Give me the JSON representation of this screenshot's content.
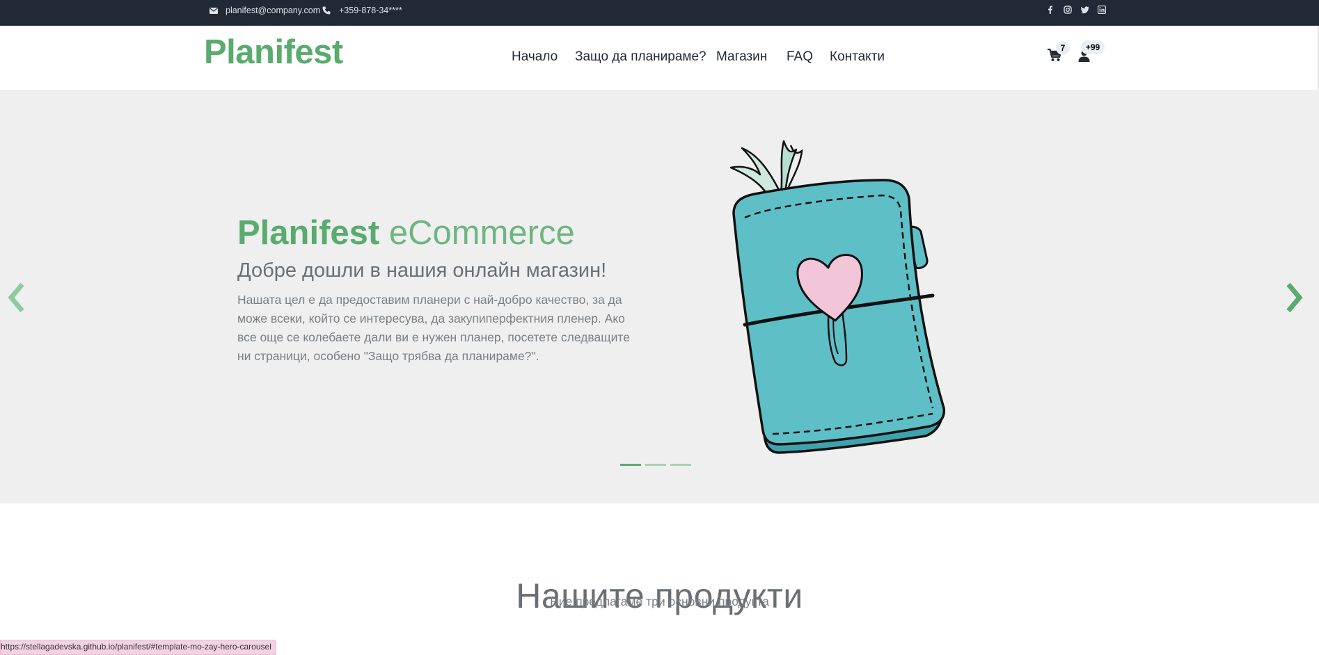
{
  "topbar": {
    "email": "planifest@company.com",
    "phone": "+359-878-34****",
    "email_icon": "envelope-icon",
    "phone_icon": "phone-icon",
    "social": [
      "facebook-icon",
      "instagram-icon",
      "twitter-icon",
      "linkedin-icon"
    ]
  },
  "header": {
    "logo": "Planifest",
    "nav": [
      "Начало",
      "Защо да планираме?",
      "Магазин",
      "FAQ",
      "Контакти"
    ],
    "cart_icon": "cart-icon",
    "cart_count": "7",
    "user_icon": "user-icon",
    "user_count": "+99"
  },
  "hero": {
    "title_bold": "Planifest",
    "title_light": "eCommerce",
    "subtitle": "Добре дошли в нашия онлайн магазин!",
    "text": "Нашата цел е да предоставим планери с най-добро качество, за да може всеки, който се интересува, да закупиперфектния пленер. Ако все още се колебаете дали ви е нужен планер, посетете следващите ни страници, особено \"Защо трябва да планираме?\".",
    "prev_icon": "chevron-left-icon",
    "next_icon": "chevron-right-icon",
    "slide_count": 3,
    "active_slide": 1,
    "image": "planner-illustration"
  },
  "products": {
    "title": "Нашите продукти",
    "subtitle": "Ние предлагаме три основни продукта"
  },
  "status_url": "https://stellagadevska.github.io/planifest/#template-mo-zay-hero-carousel",
  "colors": {
    "accent": "#59ab6e",
    "topbar": "#212934",
    "hero_bg": "#efefef"
  }
}
